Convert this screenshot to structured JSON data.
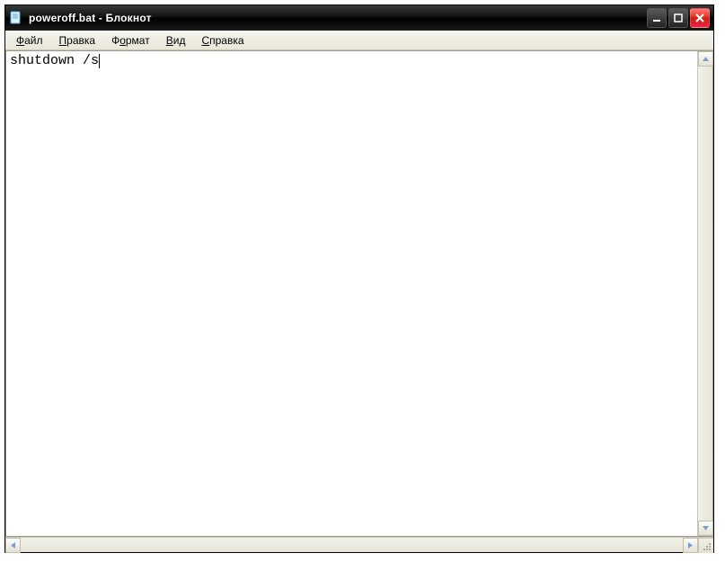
{
  "titlebar": {
    "title": "poweroff.bat - Блокнот"
  },
  "menu": {
    "file": {
      "label": "Файл",
      "accel": "Ф"
    },
    "edit": {
      "label": "Правка",
      "accel": "П"
    },
    "format": {
      "label": "Формат",
      "accel": "о"
    },
    "view": {
      "label": "Вид",
      "accel": "В"
    },
    "help": {
      "label": "Справка",
      "accel": "С"
    }
  },
  "editor": {
    "content": "shutdown /s"
  }
}
